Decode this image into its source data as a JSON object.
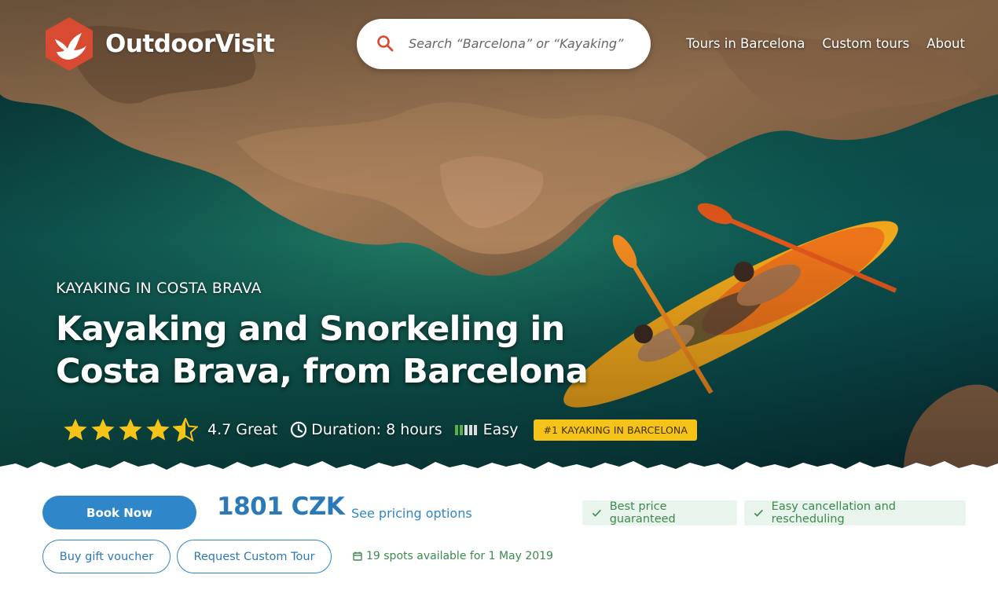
{
  "brand": {
    "name": "OutdoorVisit"
  },
  "search": {
    "placeholder": "Search “Barcelona” or “Kayaking”"
  },
  "nav": {
    "items": [
      "Tours in Barcelona",
      "Custom tours",
      "About"
    ]
  },
  "hero": {
    "eyebrow": "KAYAKING IN COSTA BRAVA",
    "title": "Kayaking and Snorkeling in Costa Brava, from Barcelona",
    "rating_stars": 4.5,
    "rating_text": "4.7 Great",
    "duration": "Duration: 8 hours",
    "difficulty": "Easy",
    "badge": "#1 KAYAKING IN BARCELONA"
  },
  "booking": {
    "book_label": "Book Now",
    "price": "1801 CZK",
    "pricing_link": "See pricing options",
    "perks": [
      "Best price guaranteed",
      "Easy cancellation and rescheduling"
    ],
    "voucher_label": "Buy gift voucher",
    "custom_label": "Request Custom Tour",
    "spots": "19 spots available for 1 May 2019"
  },
  "colors": {
    "brand_red": "#d94a33",
    "primary_blue": "#2f86c9",
    "price_blue": "#2c79b8",
    "badge_yellow": "#f6c419",
    "star_yellow": "#f6c419",
    "success_green": "#3c8a4e",
    "success_bg": "#e8f4ec"
  },
  "icons": [
    "logo-bird-icon",
    "search-icon",
    "star-icon",
    "clock-icon",
    "difficulty-bars-icon",
    "check-icon",
    "calendar-icon"
  ]
}
